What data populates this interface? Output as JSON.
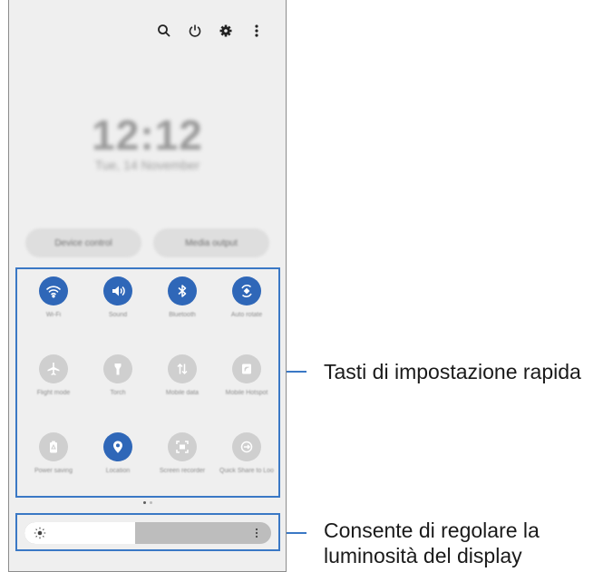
{
  "top_icons": [
    "search-icon",
    "power-icon",
    "gear-icon",
    "more-vert-icon"
  ],
  "clock": "12:12",
  "date": "Tue, 14 November",
  "buttons": {
    "device_control": "Device control",
    "media_output": "Media output"
  },
  "tiles": [
    {
      "icon": "wifi-icon",
      "label": "Wi-Fi",
      "on": true
    },
    {
      "icon": "sound-icon",
      "label": "Sound",
      "on": true
    },
    {
      "icon": "bluetooth-icon",
      "label": "Bluetooth",
      "on": true
    },
    {
      "icon": "auto-rotate-icon",
      "label": "Auto rotate",
      "on": true
    },
    {
      "icon": "airplane-icon",
      "label": "Flight mode",
      "on": false
    },
    {
      "icon": "flashlight-icon",
      "label": "Torch",
      "on": false
    },
    {
      "icon": "mobile-data-icon",
      "label": "Mobile data",
      "on": false
    },
    {
      "icon": "hotspot-icon",
      "label": "Mobile Hotspot",
      "on": false
    },
    {
      "icon": "power-saving-icon",
      "label": "Power saving",
      "on": false
    },
    {
      "icon": "location-icon",
      "label": "Location",
      "on": true
    },
    {
      "icon": "screen-recorder-icon",
      "label": "Screen recorder",
      "on": false
    },
    {
      "icon": "quick-share-icon",
      "label": "Quick Share to Loo",
      "on": false
    }
  ],
  "brightness": {
    "level": 0.45
  },
  "callouts": {
    "quick_settings": "Tasti di impostazione rapida",
    "brightness_line1": "Consente di regolare la",
    "brightness_line2": "luminosità del display"
  },
  "colors": {
    "accent": "#2f67b8",
    "highlight": "#3a78c5",
    "panel": "#efefef"
  }
}
